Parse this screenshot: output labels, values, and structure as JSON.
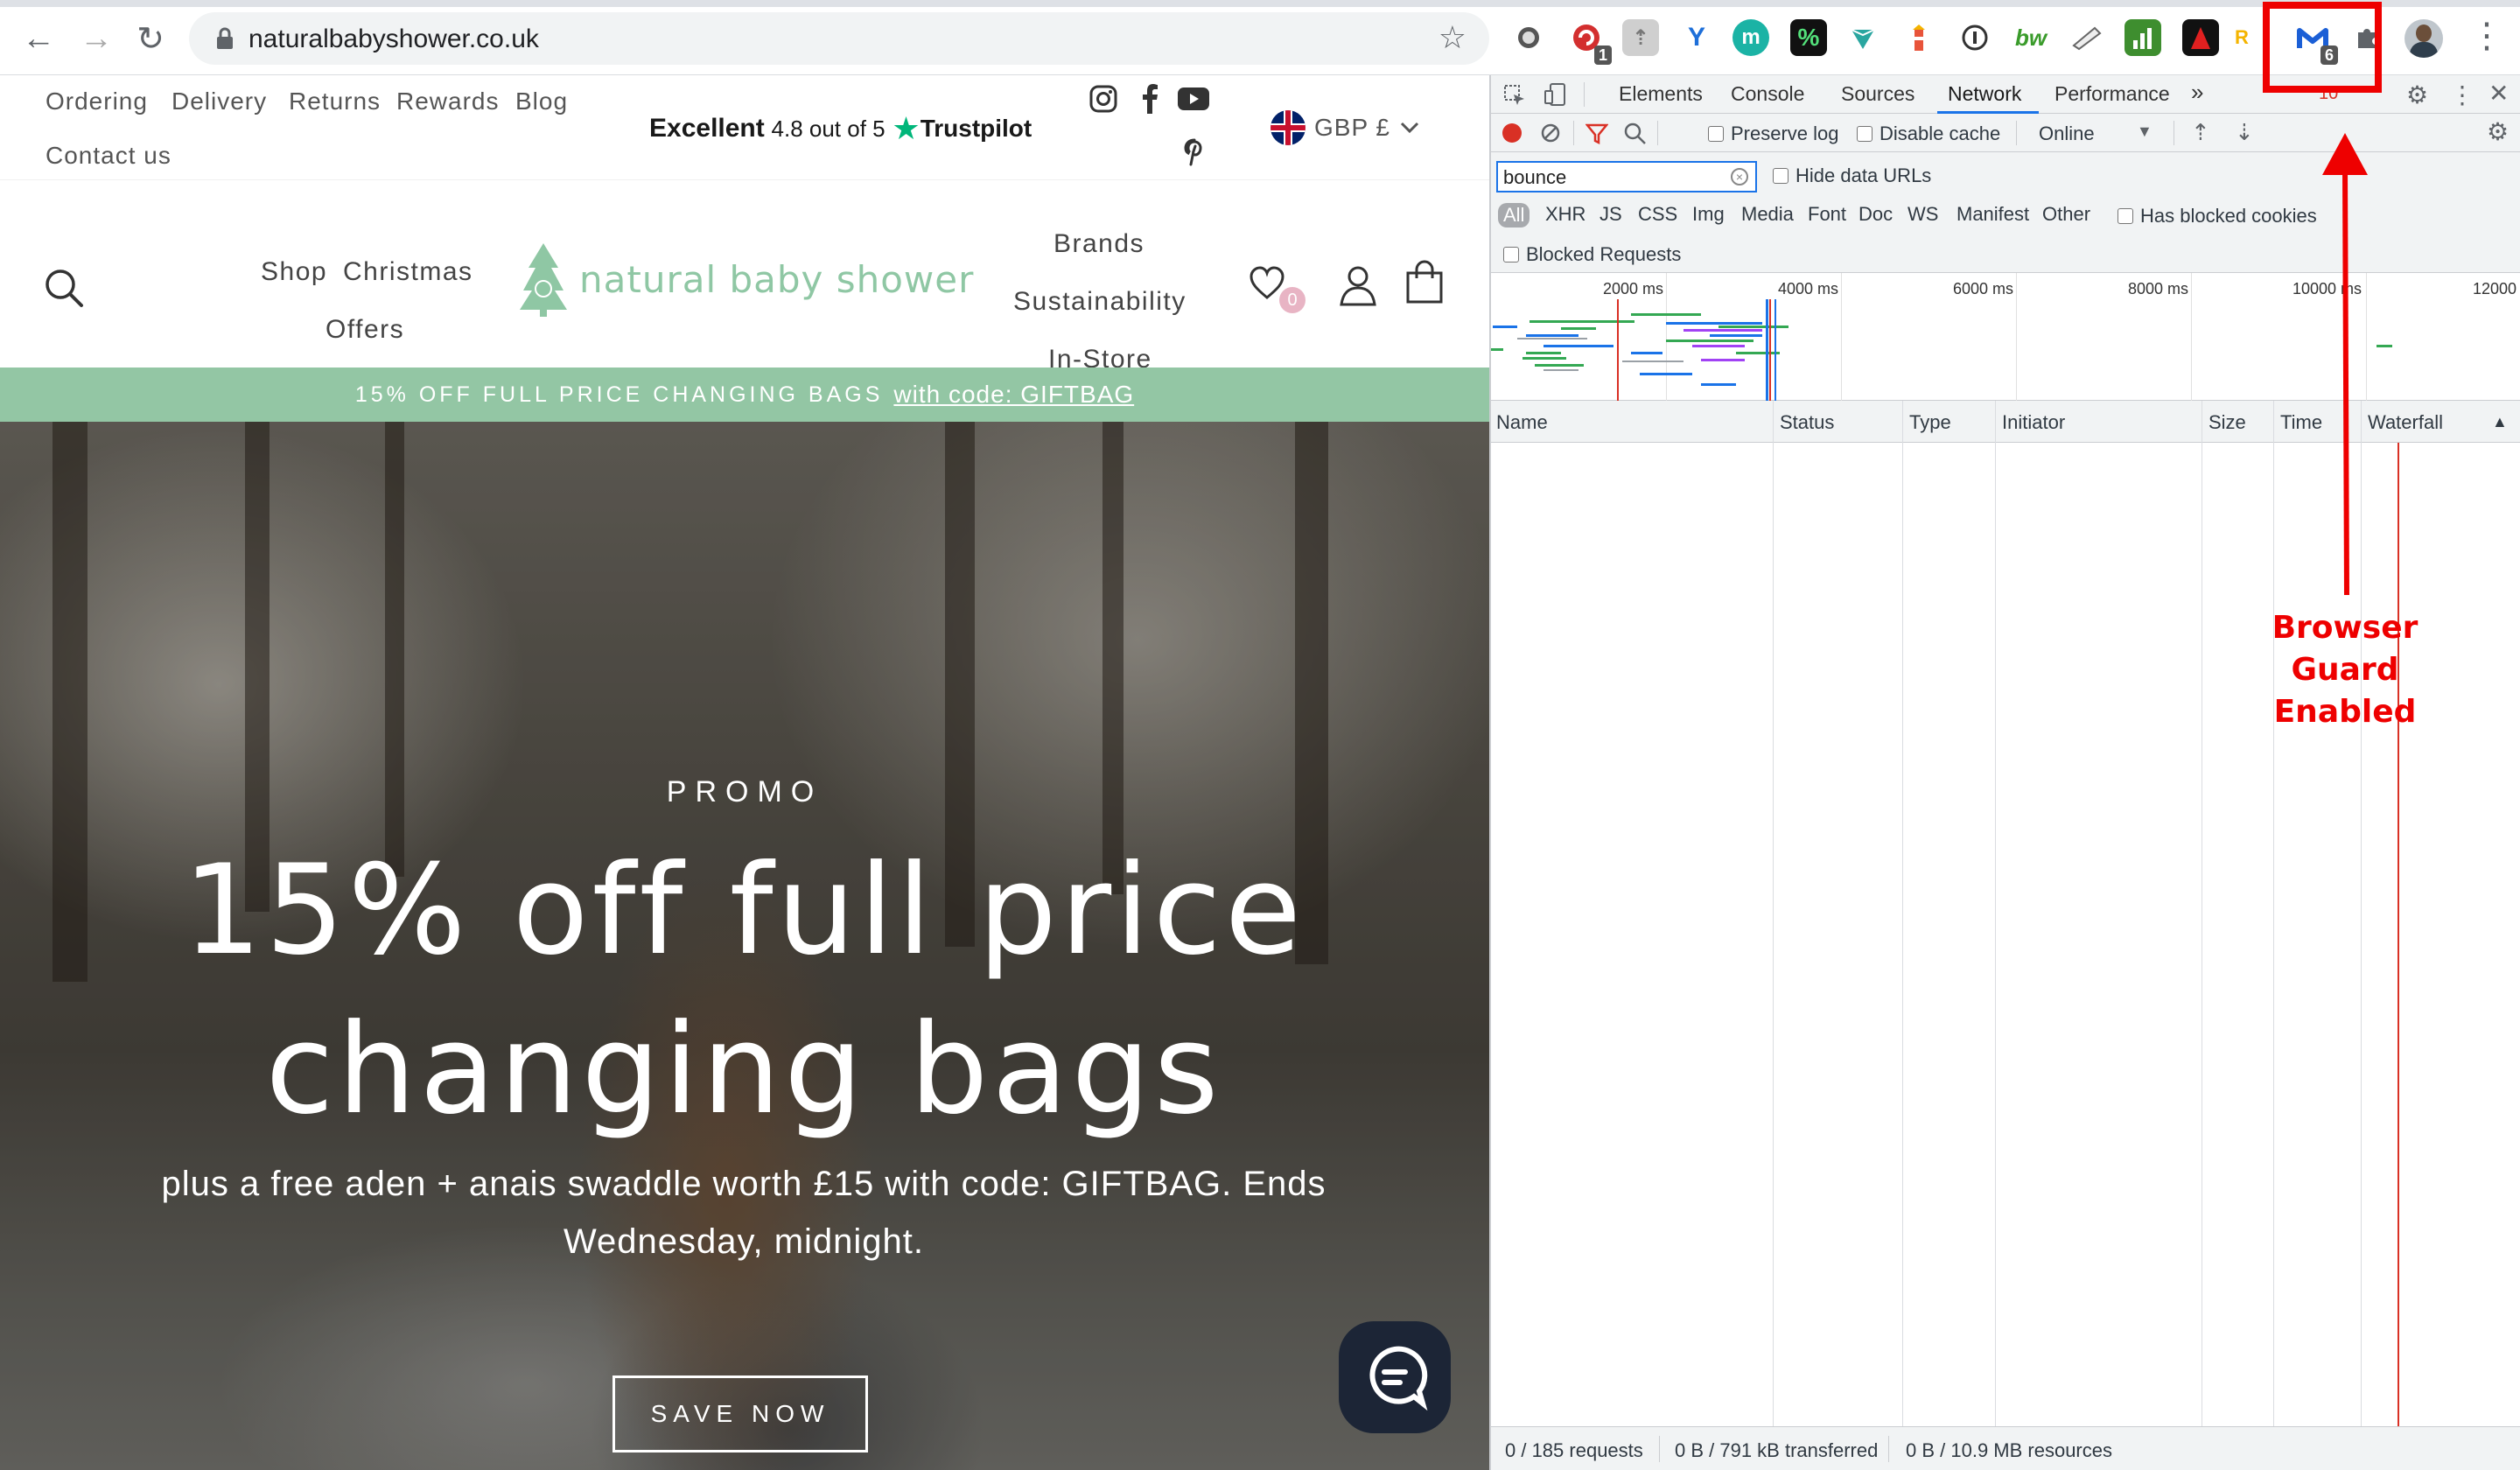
{
  "browser": {
    "url": "naturalbabyshower.co.uk",
    "extension_badges": {
      "ext_red": "1",
      "malwarebytes": "6"
    }
  },
  "site": {
    "utility_nav": [
      "Ordering",
      "Delivery",
      "Returns",
      "Rewards",
      "Blog",
      "Contact us"
    ],
    "trustpilot": {
      "rating_word": "Excellent",
      "score": "4.8 out of 5",
      "brand": "Trustpilot"
    },
    "currency": "GBP £",
    "main_nav": {
      "shop": "Shop",
      "christmas": "Christmas",
      "offers": "Offers",
      "brands": "Brands",
      "sustainability": "Sustainability",
      "in_store": "In-Store"
    },
    "logo": "natural baby shower",
    "wishlist_count": "0",
    "promo_strip": {
      "text": "15% OFF FULL PRICE CHANGING BAGS",
      "link": "with code: GIFTBAG"
    },
    "hero": {
      "kicker": "PROMO",
      "headline": "15% off full price changing bags",
      "subtext": "plus a free aden + anais swaddle worth £15 with code: GIFTBAG. Ends Wednesday, midnight.",
      "cta": "SAVE NOW"
    }
  },
  "devtools": {
    "tabs": [
      "Elements",
      "Console",
      "Sources",
      "Network",
      "Performance"
    ],
    "active_tab": "Network",
    "overflow": "»",
    "error_count": "10",
    "toolbar": {
      "preserve_log": "Preserve log",
      "disable_cache": "Disable cache",
      "throttling": "Online"
    },
    "filter": {
      "value": "bounce",
      "hide_data_urls": "Hide data URLs"
    },
    "types": [
      "All",
      "XHR",
      "JS",
      "CSS",
      "Img",
      "Media",
      "Font",
      "Doc",
      "WS",
      "Manifest",
      "Other"
    ],
    "has_blocked_cookies": "Has blocked cookies",
    "blocked_requests": "Blocked Requests",
    "overview_ticks": [
      "2000 ms",
      "4000 ms",
      "6000 ms",
      "8000 ms",
      "10000 ms",
      "12000"
    ],
    "columns": [
      "Name",
      "Status",
      "Type",
      "Initiator",
      "Size",
      "Time",
      "Waterfall"
    ],
    "status": {
      "requests": "0 / 185 requests",
      "transferred": "0 B / 791 kB transferred",
      "resources": "0 B / 10.9 MB resources"
    }
  },
  "annotation": {
    "line1": "Browser Guard",
    "line2": "Enabled",
    "color": "#e00000"
  }
}
